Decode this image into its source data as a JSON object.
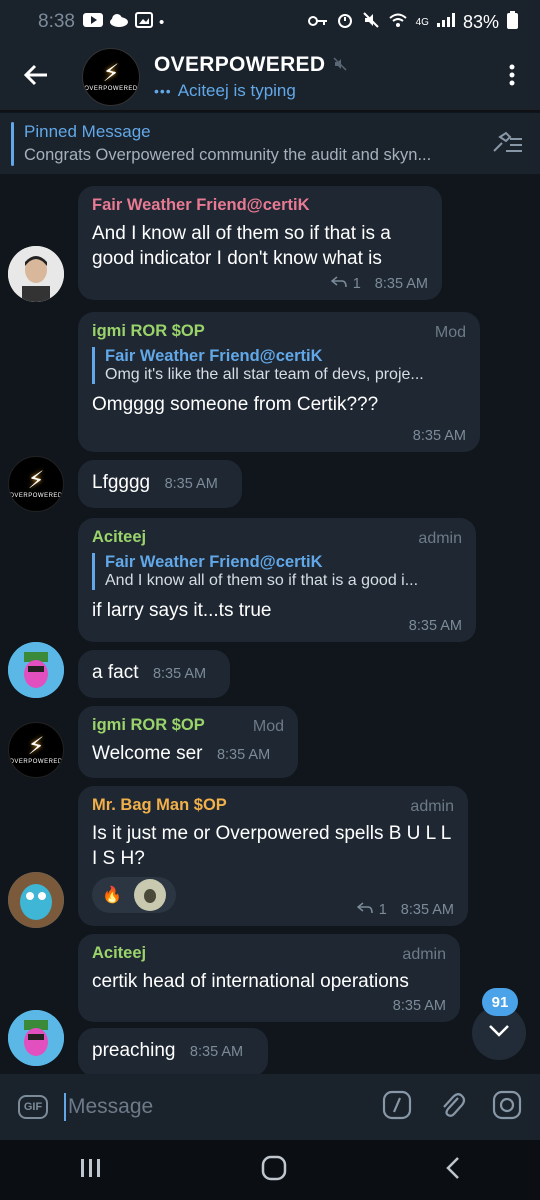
{
  "status": {
    "time": "8:38",
    "battery": "83%",
    "network": "4G"
  },
  "header": {
    "title": "OVERPOWERED",
    "typing": "Aciteej is typing",
    "avatar_word": "OVERPOWERED"
  },
  "pinned": {
    "title": "Pinned Message",
    "text": "Congrats Overpowered community the audit and skyn..."
  },
  "messages": [
    {
      "sender": "Fair Weather Friend@certiK",
      "text": "And I know all of them so if that is a good indicator I don't know what is",
      "replies": "1",
      "time": "8:35 AM"
    },
    {
      "sender": "igmi ROR $OP",
      "role": "Mod",
      "quote_name": "Fair Weather Friend@certiK",
      "quote_text": "Omg it's like the all star team of devs, proje...",
      "text": "Omgggg someone from Certik???",
      "time": "8:35 AM"
    },
    {
      "text": "Lfgggg",
      "time": "8:35 AM"
    },
    {
      "sender": "Aciteej",
      "role": "admin",
      "quote_name": "Fair Weather Friend@certiK",
      "quote_text": "And I know all of them so if that is a good i...",
      "text": "if larry says it...ts true",
      "time": "8:35 AM"
    },
    {
      "text": "a fact",
      "time": "8:35 AM"
    },
    {
      "sender": "igmi ROR $OP",
      "role": "Mod",
      "text": "Welcome ser",
      "time": "8:35 AM"
    },
    {
      "sender": "Mr. Bag Man $OP",
      "role": "admin",
      "text": "Is it just me or Overpowered spells B U L L I S H?",
      "reactions": [
        "🔥"
      ],
      "replies": "1",
      "time": "8:35 AM"
    },
    {
      "sender": "Aciteej",
      "role": "admin",
      "text": "certik head of international operations",
      "time": "8:35 AM"
    },
    {
      "text": "preaching",
      "time": "8:35 AM"
    }
  ],
  "unread_count": "91",
  "input": {
    "placeholder": "Message",
    "gif_label": "GIF"
  },
  "colors": {
    "accent": "#62a8e8",
    "name_pink": "#e97a93",
    "name_green": "#9bd36b",
    "name_orange": "#f2b04a",
    "bubble": "#1e2732"
  }
}
